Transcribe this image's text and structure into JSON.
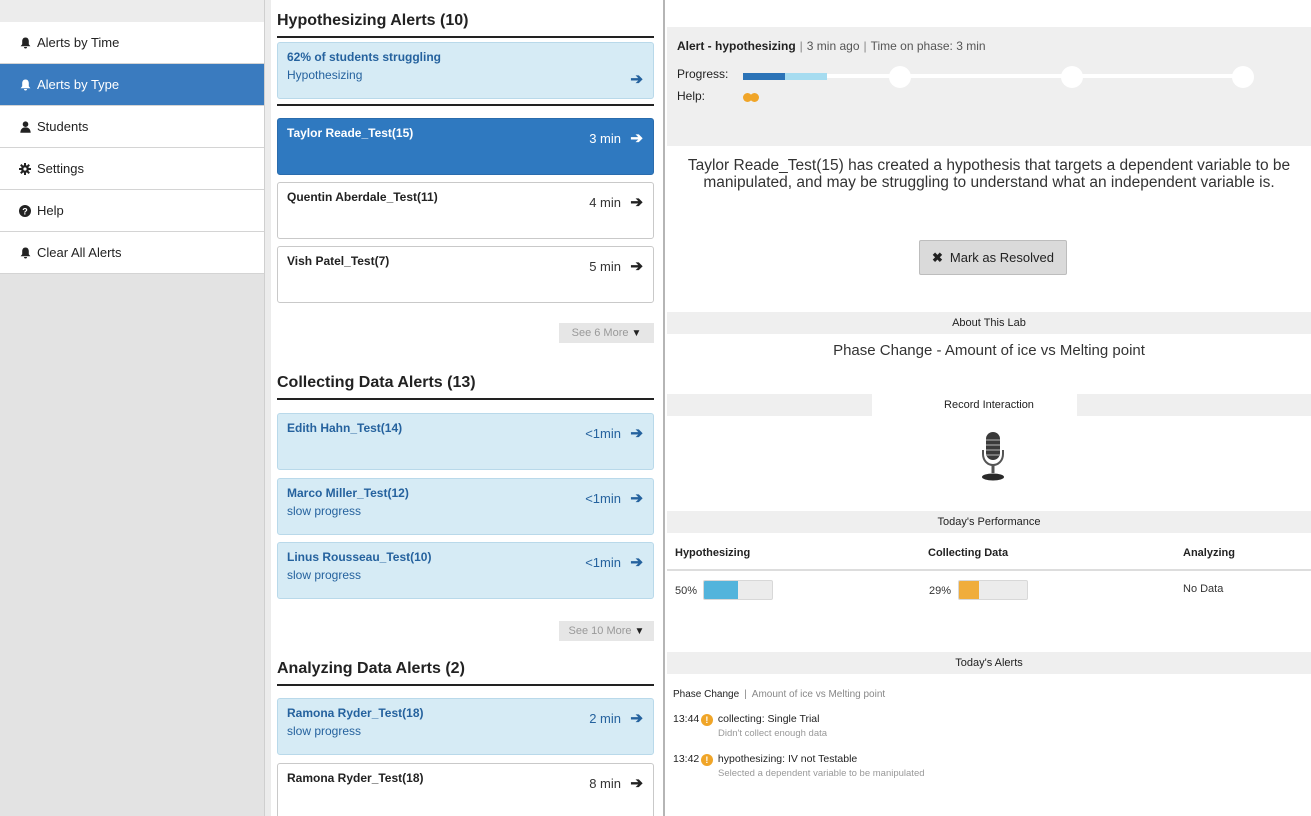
{
  "sidebar": {
    "items": [
      {
        "label": "Alerts by Time",
        "icon": "bell-icon",
        "active": false
      },
      {
        "label": "Alerts by Type",
        "icon": "bell-icon",
        "active": true
      },
      {
        "label": "Students",
        "icon": "user-icon",
        "active": false
      },
      {
        "label": "Settings",
        "icon": "gear-icon",
        "active": false
      },
      {
        "label": "Help",
        "icon": "question-circle-icon",
        "active": false
      },
      {
        "label": "Clear All Alerts",
        "icon": "bell-icon",
        "active": false
      }
    ]
  },
  "alerts": {
    "hypothesizing": {
      "title": "Hypothesizing Alerts (10)",
      "summary": {
        "title": "62% of students struggling",
        "subtitle": "Hypothesizing"
      },
      "cards": [
        {
          "name": "Taylor Reade_Test(15)",
          "time": "3 min",
          "selected": true
        },
        {
          "name": "Quentin Aberdale_Test(11)",
          "time": "4 min"
        },
        {
          "name": "Vish Patel_Test(7)",
          "time": "5 min"
        }
      ],
      "see_more": "See 6 More"
    },
    "collecting": {
      "title": "Collecting Data Alerts (13)",
      "cards": [
        {
          "name": "Edith Hahn_Test(14)",
          "time": "<1min",
          "sub": ""
        },
        {
          "name": "Marco Miller_Test(12)",
          "time": "<1min",
          "sub": "slow progress"
        },
        {
          "name": "Linus Rousseau_Test(10)",
          "time": "<1min",
          "sub": "slow progress"
        }
      ],
      "see_more": "See 10 More"
    },
    "analyzing": {
      "title": "Analyzing Data Alerts (2)",
      "cards": [
        {
          "name": "Ramona Ryder_Test(18)",
          "time": "2 min",
          "sub": "slow progress"
        },
        {
          "name": "Ramona Ryder_Test(18)",
          "time": "8 min"
        }
      ]
    }
  },
  "detail": {
    "alert_label": "Alert - hypothesizing",
    "ago": "3 min ago",
    "time_on_phase": "Time on phase: 3 min",
    "progress_label": "Progress:",
    "help_label": "Help:",
    "help_count": 2,
    "message": "Taylor Reade_Test(15) has created a hypothesis that targets a dependent variable to be manipulated, and may be struggling to understand what an independent variable is.",
    "resolve_label": "Mark as Resolved",
    "about_header": "About This Lab",
    "lab_name": "Phase Change - Amount of ice vs Melting point",
    "record_header": "Record Interaction",
    "perf_header": "Today's Performance",
    "perf": [
      {
        "label": "Hypothesizing",
        "value": "50%",
        "fraction": 0.5,
        "color": "#52b4dc"
      },
      {
        "label": "Collecting Data",
        "value": "29%",
        "fraction": 0.29,
        "color": "#f0ad3c"
      },
      {
        "label": "Analyzing",
        "value": "No Data"
      }
    ],
    "todays_alerts_header": "Today's Alerts",
    "todays_alerts_lab": "Phase Change",
    "todays_alerts_lab_sub": "Amount of ice vs Melting point",
    "todays_alerts": [
      {
        "time": "13:44",
        "text": "collecting: Single Trial",
        "sub": "Didn't collect enough data"
      },
      {
        "time": "13:42",
        "text": "hypothesizing: IV not Testable",
        "sub": "Selected a dependent variable to be manipulated"
      }
    ]
  }
}
